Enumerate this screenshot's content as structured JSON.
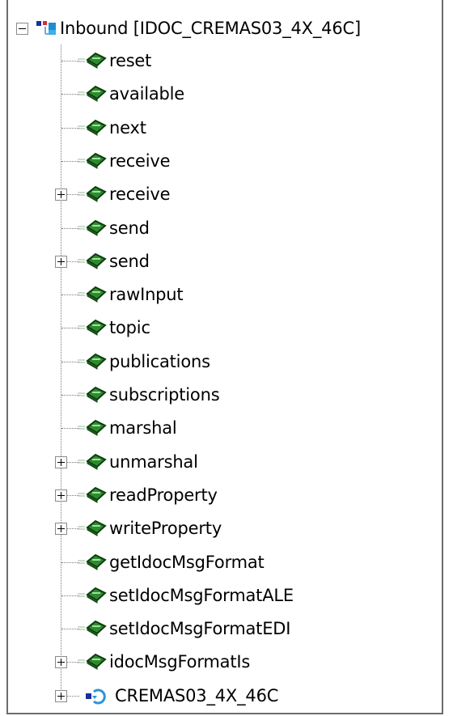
{
  "tree": {
    "root": {
      "label": "Inbound [IDOC_CREMAS03_4X_46C]",
      "expanded": true,
      "icon": "object-icon"
    },
    "children": [
      {
        "label": "reset",
        "expandable": false,
        "icon": "method-icon"
      },
      {
        "label": "available",
        "expandable": false,
        "icon": "method-icon"
      },
      {
        "label": "next",
        "expandable": false,
        "icon": "method-icon"
      },
      {
        "label": "receive",
        "expandable": false,
        "icon": "method-icon"
      },
      {
        "label": "receive",
        "expandable": true,
        "icon": "method-icon"
      },
      {
        "label": "send",
        "expandable": false,
        "icon": "method-icon"
      },
      {
        "label": "send",
        "expandable": true,
        "icon": "method-icon"
      },
      {
        "label": "rawInput",
        "expandable": false,
        "icon": "method-icon"
      },
      {
        "label": "topic",
        "expandable": false,
        "icon": "method-icon"
      },
      {
        "label": "publications",
        "expandable": false,
        "icon": "method-icon"
      },
      {
        "label": "subscriptions",
        "expandable": false,
        "icon": "method-icon"
      },
      {
        "label": "marshal",
        "expandable": false,
        "icon": "method-icon"
      },
      {
        "label": "unmarshal",
        "expandable": true,
        "icon": "method-icon"
      },
      {
        "label": "readProperty",
        "expandable": true,
        "icon": "method-icon"
      },
      {
        "label": "writeProperty",
        "expandable": true,
        "icon": "method-icon"
      },
      {
        "label": "getIdocMsgFormat",
        "expandable": false,
        "icon": "method-icon"
      },
      {
        "label": "setIdocMsgFormatALE",
        "expandable": false,
        "icon": "method-icon"
      },
      {
        "label": "setIdocMsgFormatEDI",
        "expandable": false,
        "icon": "method-icon"
      },
      {
        "label": "idocMsgFormatIs",
        "expandable": true,
        "icon": "method-icon"
      },
      {
        "label": "CREMAS03_4X_46C",
        "expandable": true,
        "icon": "idoc-object-icon"
      }
    ],
    "colors": {
      "method_icon": "#2f8a2f",
      "dotted_line": "#7a7a7a",
      "text": "#000000",
      "border": "#6c6c6c"
    }
  }
}
